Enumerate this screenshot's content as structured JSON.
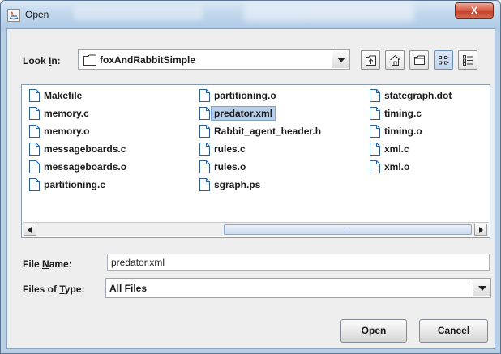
{
  "window": {
    "title": "Open",
    "close_label": "X"
  },
  "look_in": {
    "label_prefix": "Look ",
    "label_mnemonic": "I",
    "label_suffix": "n:",
    "value": "foxAndRabbitSimple"
  },
  "toolbar": {
    "buttons": [
      "up-one-level-icon",
      "home-icon",
      "new-folder-icon",
      "list-view-icon",
      "details-view-icon"
    ]
  },
  "files": {
    "column1": [
      "Makefile",
      "memory.c",
      "memory.o",
      "messageboards.c",
      "messageboards.o",
      "partitioning.c"
    ],
    "column2": [
      "partitioning.o",
      "predator.xml",
      "Rabbit_agent_header.h",
      "rules.c",
      "rules.o",
      "sgraph.ps"
    ],
    "column3": [
      "stategraph.dot",
      "timing.c",
      "timing.o",
      "xml.c",
      "xml.o"
    ],
    "selected": "predator.xml"
  },
  "file_name": {
    "label_prefix": "File ",
    "label_mnemonic": "N",
    "label_suffix": "ame:",
    "value": "predator.xml"
  },
  "file_type": {
    "label_prefix": "Files of ",
    "label_mnemonic": "T",
    "label_suffix": "ype:",
    "value": "All Files"
  },
  "buttons": {
    "open": "Open",
    "cancel": "Cancel"
  },
  "colors": {
    "selection": "#b8cfe9",
    "close_button": "#c3412a"
  }
}
